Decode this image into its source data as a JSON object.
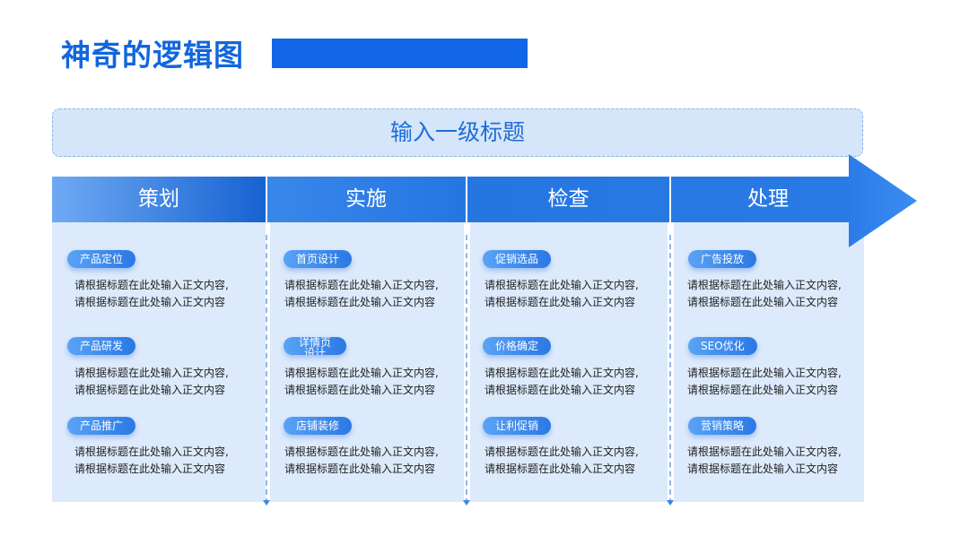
{
  "title": "神奇的逻辑图",
  "banner": "输入一级标题",
  "columns": [
    {
      "header": "策划",
      "items": [
        {
          "tag": "产品定位",
          "line1": "请根据标题在此处输入正文内容,",
          "line2": "请根据标题在此处输入正文内容"
        },
        {
          "tag": "产品研发",
          "line1": "请根据标题在此处输入正文内容,",
          "line2": "请根据标题在此处输入正文内容"
        },
        {
          "tag": "产品推广",
          "line1": "请根据标题在此处输入正文内容,",
          "line2": "请根据标题在此处输入正文内容"
        }
      ]
    },
    {
      "header": "实施",
      "items": [
        {
          "tag": "首页设计",
          "line1": "请根据标题在此处输入正文内容,",
          "line2": "请根据标题在此处输入正文内容"
        },
        {
          "tag": "详情页设计",
          "line1": "请根据标题在此处输入正文内容,",
          "line2": "请根据标题在此处输入正文内容"
        },
        {
          "tag": "店铺装修",
          "line1": "请根据标题在此处输入正文内容,",
          "line2": "请根据标题在此处输入正文内容"
        }
      ]
    },
    {
      "header": "检查",
      "items": [
        {
          "tag": "促销选品",
          "line1": "请根据标题在此处输入正文内容,",
          "line2": "请根据标题在此处输入正文内容"
        },
        {
          "tag": "价格确定",
          "line1": "请根据标题在此处输入正文内容,",
          "line2": "请根据标题在此处输入正文内容"
        },
        {
          "tag": "让利促销",
          "line1": "请根据标题在此处输入正文内容,",
          "line2": "请根据标题在此处输入正文内容"
        }
      ]
    },
    {
      "header": "处理",
      "items": [
        {
          "tag": "广告投放",
          "line1": "请根据标题在此处输入正文内容,",
          "line2": "请根据标题在此处输入正文内容"
        },
        {
          "tag": "SEO优化",
          "line1": "请根据标题在此处输入正文内容,",
          "line2": "请根据标题在此处输入正文内容"
        },
        {
          "tag": "营销策略",
          "line1": "请根据标题在此处输入正文内容,",
          "line2": "请根据标题在此处输入正文内容"
        }
      ]
    }
  ],
  "colors": {
    "title": "#1166dd",
    "accent": "#1167e8",
    "panel": "#ddeafb",
    "banner": "#d6e6fa"
  }
}
